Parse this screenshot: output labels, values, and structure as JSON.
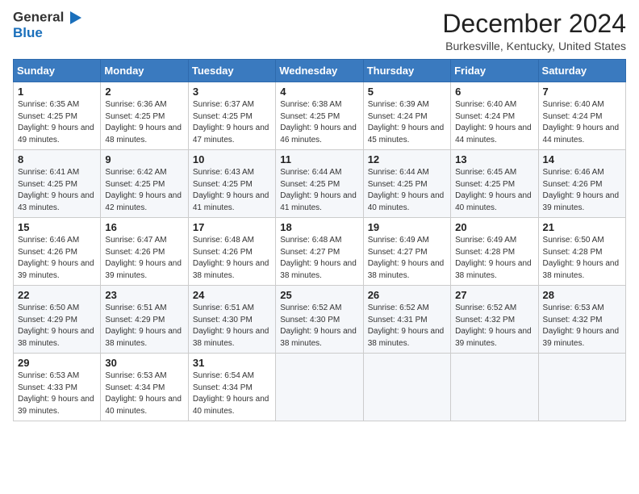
{
  "logo": {
    "general": "General",
    "blue": "Blue"
  },
  "title": "December 2024",
  "location": "Burkesville, Kentucky, United States",
  "days_of_week": [
    "Sunday",
    "Monday",
    "Tuesday",
    "Wednesday",
    "Thursday",
    "Friday",
    "Saturday"
  ],
  "weeks": [
    [
      {
        "day": "1",
        "sunrise": "Sunrise: 6:35 AM",
        "sunset": "Sunset: 4:25 PM",
        "daylight": "Daylight: 9 hours and 49 minutes."
      },
      {
        "day": "2",
        "sunrise": "Sunrise: 6:36 AM",
        "sunset": "Sunset: 4:25 PM",
        "daylight": "Daylight: 9 hours and 48 minutes."
      },
      {
        "day": "3",
        "sunrise": "Sunrise: 6:37 AM",
        "sunset": "Sunset: 4:25 PM",
        "daylight": "Daylight: 9 hours and 47 minutes."
      },
      {
        "day": "4",
        "sunrise": "Sunrise: 6:38 AM",
        "sunset": "Sunset: 4:25 PM",
        "daylight": "Daylight: 9 hours and 46 minutes."
      },
      {
        "day": "5",
        "sunrise": "Sunrise: 6:39 AM",
        "sunset": "Sunset: 4:24 PM",
        "daylight": "Daylight: 9 hours and 45 minutes."
      },
      {
        "day": "6",
        "sunrise": "Sunrise: 6:40 AM",
        "sunset": "Sunset: 4:24 PM",
        "daylight": "Daylight: 9 hours and 44 minutes."
      },
      {
        "day": "7",
        "sunrise": "Sunrise: 6:40 AM",
        "sunset": "Sunset: 4:24 PM",
        "daylight": "Daylight: 9 hours and 44 minutes."
      }
    ],
    [
      {
        "day": "8",
        "sunrise": "Sunrise: 6:41 AM",
        "sunset": "Sunset: 4:25 PM",
        "daylight": "Daylight: 9 hours and 43 minutes."
      },
      {
        "day": "9",
        "sunrise": "Sunrise: 6:42 AM",
        "sunset": "Sunset: 4:25 PM",
        "daylight": "Daylight: 9 hours and 42 minutes."
      },
      {
        "day": "10",
        "sunrise": "Sunrise: 6:43 AM",
        "sunset": "Sunset: 4:25 PM",
        "daylight": "Daylight: 9 hours and 41 minutes."
      },
      {
        "day": "11",
        "sunrise": "Sunrise: 6:44 AM",
        "sunset": "Sunset: 4:25 PM",
        "daylight": "Daylight: 9 hours and 41 minutes."
      },
      {
        "day": "12",
        "sunrise": "Sunrise: 6:44 AM",
        "sunset": "Sunset: 4:25 PM",
        "daylight": "Daylight: 9 hours and 40 minutes."
      },
      {
        "day": "13",
        "sunrise": "Sunrise: 6:45 AM",
        "sunset": "Sunset: 4:25 PM",
        "daylight": "Daylight: 9 hours and 40 minutes."
      },
      {
        "day": "14",
        "sunrise": "Sunrise: 6:46 AM",
        "sunset": "Sunset: 4:26 PM",
        "daylight": "Daylight: 9 hours and 39 minutes."
      }
    ],
    [
      {
        "day": "15",
        "sunrise": "Sunrise: 6:46 AM",
        "sunset": "Sunset: 4:26 PM",
        "daylight": "Daylight: 9 hours and 39 minutes."
      },
      {
        "day": "16",
        "sunrise": "Sunrise: 6:47 AM",
        "sunset": "Sunset: 4:26 PM",
        "daylight": "Daylight: 9 hours and 39 minutes."
      },
      {
        "day": "17",
        "sunrise": "Sunrise: 6:48 AM",
        "sunset": "Sunset: 4:26 PM",
        "daylight": "Daylight: 9 hours and 38 minutes."
      },
      {
        "day": "18",
        "sunrise": "Sunrise: 6:48 AM",
        "sunset": "Sunset: 4:27 PM",
        "daylight": "Daylight: 9 hours and 38 minutes."
      },
      {
        "day": "19",
        "sunrise": "Sunrise: 6:49 AM",
        "sunset": "Sunset: 4:27 PM",
        "daylight": "Daylight: 9 hours and 38 minutes."
      },
      {
        "day": "20",
        "sunrise": "Sunrise: 6:49 AM",
        "sunset": "Sunset: 4:28 PM",
        "daylight": "Daylight: 9 hours and 38 minutes."
      },
      {
        "day": "21",
        "sunrise": "Sunrise: 6:50 AM",
        "sunset": "Sunset: 4:28 PM",
        "daylight": "Daylight: 9 hours and 38 minutes."
      }
    ],
    [
      {
        "day": "22",
        "sunrise": "Sunrise: 6:50 AM",
        "sunset": "Sunset: 4:29 PM",
        "daylight": "Daylight: 9 hours and 38 minutes."
      },
      {
        "day": "23",
        "sunrise": "Sunrise: 6:51 AM",
        "sunset": "Sunset: 4:29 PM",
        "daylight": "Daylight: 9 hours and 38 minutes."
      },
      {
        "day": "24",
        "sunrise": "Sunrise: 6:51 AM",
        "sunset": "Sunset: 4:30 PM",
        "daylight": "Daylight: 9 hours and 38 minutes."
      },
      {
        "day": "25",
        "sunrise": "Sunrise: 6:52 AM",
        "sunset": "Sunset: 4:30 PM",
        "daylight": "Daylight: 9 hours and 38 minutes."
      },
      {
        "day": "26",
        "sunrise": "Sunrise: 6:52 AM",
        "sunset": "Sunset: 4:31 PM",
        "daylight": "Daylight: 9 hours and 38 minutes."
      },
      {
        "day": "27",
        "sunrise": "Sunrise: 6:52 AM",
        "sunset": "Sunset: 4:32 PM",
        "daylight": "Daylight: 9 hours and 39 minutes."
      },
      {
        "day": "28",
        "sunrise": "Sunrise: 6:53 AM",
        "sunset": "Sunset: 4:32 PM",
        "daylight": "Daylight: 9 hours and 39 minutes."
      }
    ],
    [
      {
        "day": "29",
        "sunrise": "Sunrise: 6:53 AM",
        "sunset": "Sunset: 4:33 PM",
        "daylight": "Daylight: 9 hours and 39 minutes."
      },
      {
        "day": "30",
        "sunrise": "Sunrise: 6:53 AM",
        "sunset": "Sunset: 4:34 PM",
        "daylight": "Daylight: 9 hours and 40 minutes."
      },
      {
        "day": "31",
        "sunrise": "Sunrise: 6:54 AM",
        "sunset": "Sunset: 4:34 PM",
        "daylight": "Daylight: 9 hours and 40 minutes."
      },
      null,
      null,
      null,
      null
    ]
  ]
}
